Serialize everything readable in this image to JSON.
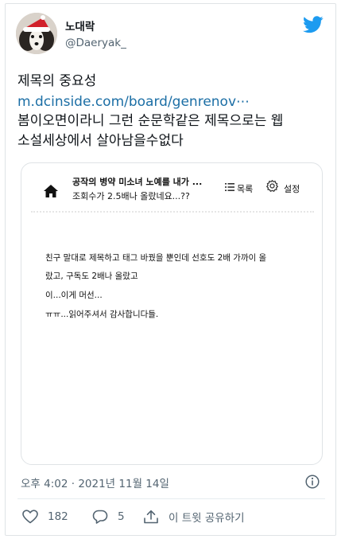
{
  "user": {
    "name": "노대락",
    "handle": "@Daeryak_"
  },
  "tweet": {
    "lines": [
      "제목의 중요성",
      "m.dcinside.com/board/genrenov⋯",
      "봄이오면이라니 그런 순문학같은 제목으로는 웹",
      "소설세상에서 살아남을수없다"
    ]
  },
  "card": {
    "title": "공작의 병약 미소녀 노예를 내가 ...",
    "subtitle": "조회수가 2.5배나 올랐네요...??",
    "list_label": "목록",
    "settings_label": "설정",
    "body": [
      "친구 말대로 제목하고 태그 바꿨을 뿐인데 선호도 2배 가까이 올",
      "랐고, 구독도 2배나 올랐고",
      "이...이게 머선...",
      "ㅠㅠ...읽어주셔서 감사합니다들."
    ]
  },
  "timestamp": "오후 4:02 · 2021년 11월 14일",
  "actions": {
    "likes": "182",
    "replies": "5",
    "share": "이 트윗 공유하기"
  },
  "colors": {
    "link": "#1b6ea5",
    "twitter_blue": "#1d9bf0",
    "muted": "#536471"
  }
}
